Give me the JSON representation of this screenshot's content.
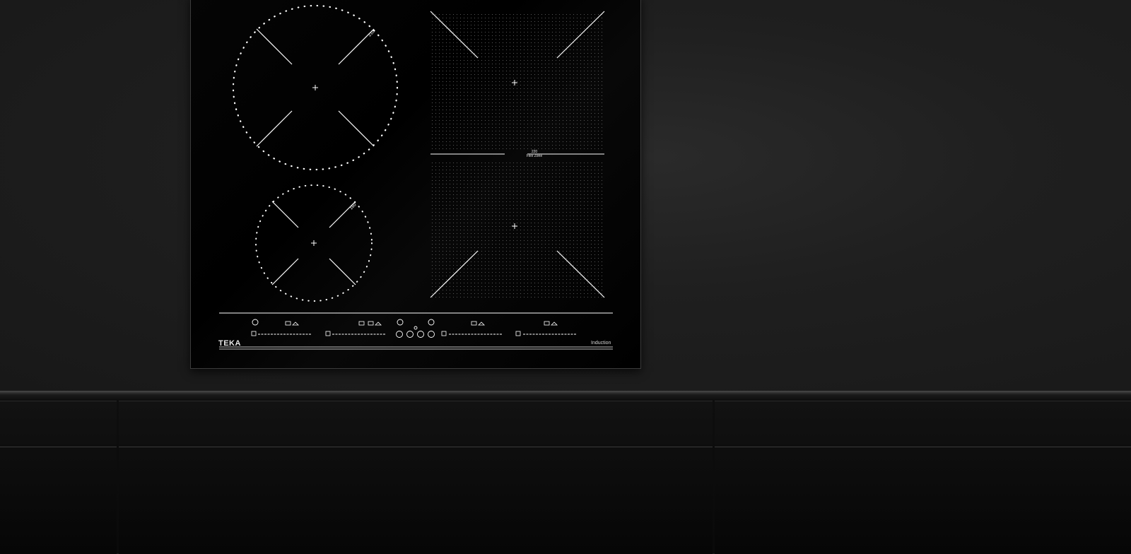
{
  "scene": {
    "brand_text": "TEKA",
    "product_type_text": "Induction",
    "flex_zone_size": "220",
    "flex_zone_label": "Flex Zone",
    "zone_large_size": "210",
    "zone_small_size": "160"
  },
  "colors": {
    "glass": "#000000",
    "wall": "#1e1e1e",
    "graphics": "#ffffff"
  }
}
